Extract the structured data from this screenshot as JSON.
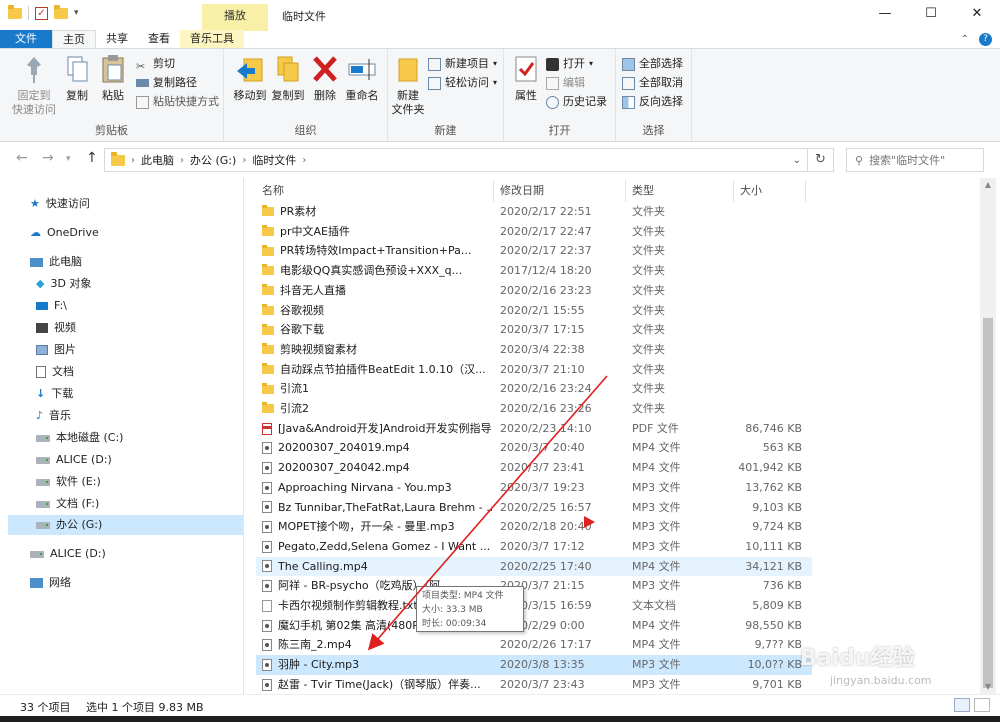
{
  "window": {
    "title": "临时文件",
    "contextual_tab_header": "播放",
    "minimize": "—",
    "maximize": "☐",
    "close": "✕"
  },
  "tabs": {
    "file": "文件",
    "home": "主页",
    "share": "共享",
    "view": "查看",
    "music_tools": "音乐工具"
  },
  "ribbon": {
    "clipboard": {
      "label": "剪贴板",
      "pin": "固定到\n快速访问",
      "copy": "复制",
      "paste": "粘贴",
      "cut": "剪切",
      "copy_path": "复制路径",
      "paste_shortcut": "粘贴快捷方式"
    },
    "organize": {
      "label": "组织",
      "move_to": "移动到",
      "copy_to": "复制到",
      "delete": "删除",
      "rename": "重命名"
    },
    "new": {
      "label": "新建",
      "new_folder": "新建\n文件夹",
      "new_item": "新建项目",
      "easy_access": "轻松访问"
    },
    "open": {
      "label": "打开",
      "properties": "属性",
      "open": "打开",
      "edit": "编辑",
      "history": "历史记录"
    },
    "select": {
      "label": "选择",
      "select_all": "全部选择",
      "select_none": "全部取消",
      "invert": "反向选择"
    }
  },
  "address": {
    "path": [
      "此电脑",
      "办公 (G:)",
      "临时文件"
    ],
    "search_placeholder": "搜索\"临时文件\""
  },
  "navpane": {
    "quick_access": "快速访问",
    "onedrive": "OneDrive",
    "this_pc": "此电脑",
    "items": [
      "3D 对象",
      "F:\\",
      "视频",
      "图片",
      "文档",
      "下载",
      "音乐",
      "本地磁盘 (C:)",
      "ALICE (D:)",
      "软件 (E:)",
      "文档 (F:)",
      "办公 (G:)"
    ],
    "alice": "ALICE (D:)",
    "network": "网络"
  },
  "columns": {
    "name": "名称",
    "date": "修改日期",
    "type": "类型",
    "size": "大小"
  },
  "files": [
    {
      "name": "PR素材",
      "date": "2020/2/17 22:51",
      "type": "文件夹",
      "size": "",
      "icon": "folder"
    },
    {
      "name": "pr中文AE插件",
      "date": "2020/2/17 22:47",
      "type": "文件夹",
      "size": "",
      "icon": "folder"
    },
    {
      "name": "PR转场特效Impact+Transition+Pa...",
      "date": "2020/2/17 22:37",
      "type": "文件夹",
      "size": "",
      "icon": "folder"
    },
    {
      "name": "电影级QQ真实感调色预设+XXX_q...",
      "date": "2017/12/4 18:20",
      "type": "文件夹",
      "size": "",
      "icon": "folder"
    },
    {
      "name": "抖音无人直播",
      "date": "2020/2/16 23:23",
      "type": "文件夹",
      "size": "",
      "icon": "folder"
    },
    {
      "name": "谷歌视频",
      "date": "2020/2/1 15:55",
      "type": "文件夹",
      "size": "",
      "icon": "folder"
    },
    {
      "name": "谷歌下载",
      "date": "2020/3/7 17:15",
      "type": "文件夹",
      "size": "",
      "icon": "folder"
    },
    {
      "name": "剪映视频窗素材",
      "date": "2020/3/4 22:38",
      "type": "文件夹",
      "size": "",
      "icon": "folder"
    },
    {
      "name": "自动踩点节拍插件BeatEdit 1.0.10（汉...",
      "date": "2020/3/7 21:10",
      "type": "文件夹",
      "size": "",
      "icon": "folder"
    },
    {
      "name": "引流1",
      "date": "2020/2/16 23:24",
      "type": "文件夹",
      "size": "",
      "icon": "folder"
    },
    {
      "name": "引流2",
      "date": "2020/2/16 23:26",
      "type": "文件夹",
      "size": "",
      "icon": "folder"
    },
    {
      "name": "[Java&Android开发]Android开发实例指导].胡孟...",
      "date": "2020/2/23 14:10",
      "type": "PDF 文件",
      "size": "86,746 KB",
      "icon": "pdf"
    },
    {
      "name": "20200307_204019.mp4",
      "date": "2020/3/7 20:40",
      "type": "MP4 文件",
      "size": "563 KB",
      "icon": "media"
    },
    {
      "name": "20200307_204042.mp4",
      "date": "2020/3/7 23:41",
      "type": "MP4 文件",
      "size": "401,942 KB",
      "icon": "media"
    },
    {
      "name": "Approaching Nirvana - You.mp3",
      "date": "2020/3/7 19:23",
      "type": "MP3 文件",
      "size": "13,762 KB",
      "icon": "media"
    },
    {
      "name": "Bz Tunnibar,TheFatRat,Laura Brehm - ...",
      "date": "2020/2/25 16:57",
      "type": "MP3 文件",
      "size": "9,103 KB",
      "icon": "media"
    },
    {
      "name": "MOPET接个吻，开一朵 - 曼里.mp3",
      "date": "2020/2/18 20:40",
      "type": "MP3 文件",
      "size": "9,724 KB",
      "icon": "media"
    },
    {
      "name": "Pegato,Zedd,Selena Gomez - I Want ...",
      "date": "2020/3/7 17:12",
      "type": "MP3 文件",
      "size": "10,111 KB",
      "icon": "media"
    },
    {
      "name": "The Calling.mp4",
      "date": "2020/2/25 17:40",
      "type": "MP4 文件",
      "size": "34,121 KB",
      "icon": "media"
    },
    {
      "name": "阿祥 - BR-psycho（吃鸡版）（阿...",
      "date": "2020/3/7 21:15",
      "type": "MP3 文件",
      "size": "736 KB",
      "icon": "media"
    },
    {
      "name": "卡西尔视频制作剪辑教程.txt",
      "date": "2020/3/15 16:59",
      "type": "文本文档",
      "size": "5,809 KB",
      "icon": "txt"
    },
    {
      "name": "魔幻手机 第02集 高清(480P).mp4",
      "date": "2020/2/29 0:00",
      "type": "MP4 文件",
      "size": "98,550 KB",
      "icon": "media"
    },
    {
      "name": "陈三南_2.mp4",
      "date": "2020/2/26 17:17",
      "type": "MP4 文件",
      "size": "9,7?? KB",
      "icon": "media"
    },
    {
      "name": "羽肿 - City.mp3",
      "date": "2020/3/8 13:35",
      "type": "MP3 文件",
      "size": "10,0?? KB",
      "icon": "media"
    },
    {
      "name": "赵雷 - Tvir Time(Jack)（钢琴版）伴奏...",
      "date": "2020/3/7 23:43",
      "type": "MP3 文件",
      "size": "9,701 KB",
      "icon": "media"
    }
  ],
  "tooltip": {
    "line1": "项目类型: MP4 文件",
    "line2": "大小: 33.3 MB",
    "line3": "时长: 00:09:34"
  },
  "status": {
    "count": "33 个项目",
    "selected": "选中 1 个项目  9.83 MB"
  },
  "watermark": {
    "brand": "Baidu经验",
    "url": "jingyan.baidu.com"
  },
  "colors": {
    "accent": "#1979ca",
    "selection": "#cce8ff",
    "hover": "#e5f3ff",
    "annotation_arrow": "#e0201f"
  }
}
